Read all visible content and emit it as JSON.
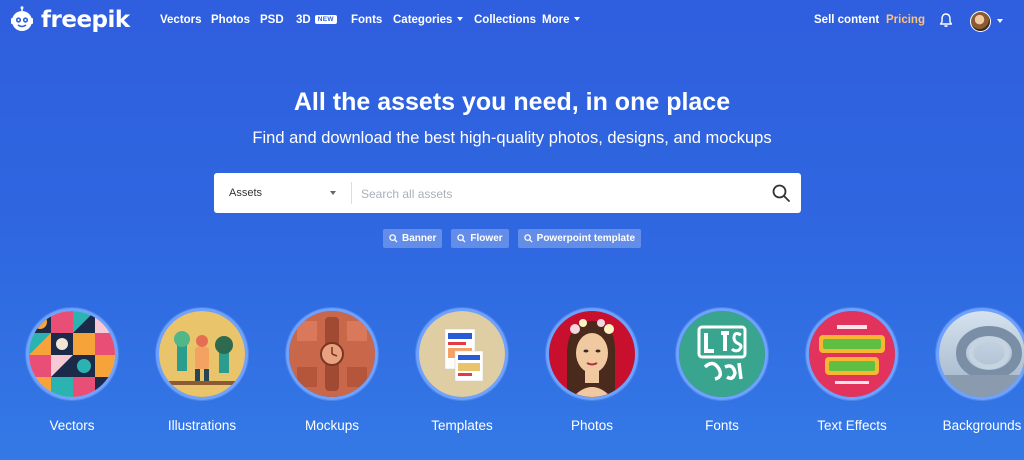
{
  "brand": {
    "name": "freepik",
    "logo_icon": "freepik-mascot-icon"
  },
  "nav": {
    "items": [
      {
        "label": "Vectors"
      },
      {
        "label": "Photos"
      },
      {
        "label": "PSD"
      },
      {
        "label": "3D",
        "badge": "NEW"
      },
      {
        "label": "Fonts"
      },
      {
        "label": "Categories",
        "dropdown": true
      },
      {
        "label": "Collections"
      },
      {
        "label": "More",
        "dropdown": true
      }
    ],
    "sell_content": "Sell content",
    "pricing": "Pricing",
    "pricing_color": "#ffc27a",
    "notifications_icon": "bell-icon"
  },
  "hero": {
    "title": "All the assets you need, in one place",
    "subtitle": "Find and download the best high-quality photos, designs, and mockups"
  },
  "search": {
    "type_selected": "Assets",
    "placeholder": "Search all assets",
    "value": "",
    "button_icon": "search-icon"
  },
  "suggestions": [
    {
      "label": "Banner"
    },
    {
      "label": "Flower"
    },
    {
      "label": "Powerpoint template"
    }
  ],
  "categories": [
    {
      "label": "Vectors"
    },
    {
      "label": "Illustrations"
    },
    {
      "label": "Mockups"
    },
    {
      "label": "Templates"
    },
    {
      "label": "Photos"
    },
    {
      "label": "Fonts"
    },
    {
      "label": "Text Effects"
    },
    {
      "label": "Backgrounds"
    }
  ],
  "colors": {
    "background": "#2f5ede",
    "accent_ring": "#6fa2ff"
  }
}
